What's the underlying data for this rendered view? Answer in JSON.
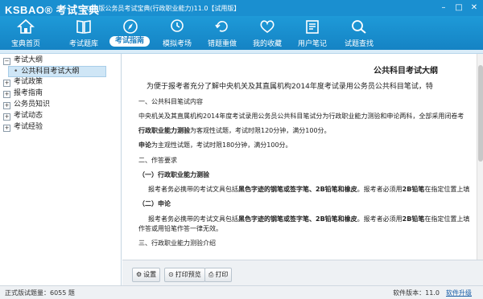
{
  "app": {
    "logo": "KSBAO® 考试宝典",
    "title": "2014版公务员考试宝典(行政职业能力)11.0【试用版】",
    "window_buttons": [
      "minimize",
      "maximize",
      "close"
    ]
  },
  "toolbar": {
    "items": [
      {
        "label": "宝典首页",
        "icon": "home-icon"
      },
      {
        "label": "考试题库",
        "icon": "book-icon"
      },
      {
        "label": "考试指南",
        "icon": "compass-icon",
        "active": true
      },
      {
        "label": "模拟考场",
        "icon": "monitor-icon"
      },
      {
        "label": "错题重做",
        "icon": "refresh-icon"
      },
      {
        "label": "我的收藏",
        "icon": "heart-icon"
      },
      {
        "label": "用户笔记",
        "icon": "notes-icon"
      },
      {
        "label": "试题查找",
        "icon": "search-icon"
      }
    ]
  },
  "sidebar": {
    "items": [
      {
        "label": "考试大纲",
        "expanded": true
      },
      {
        "label": "公共科目考试大纲",
        "selected": true,
        "child": true
      },
      {
        "label": "考试政策"
      },
      {
        "label": "报考指南"
      },
      {
        "label": "公务员知识"
      },
      {
        "label": "考试动态"
      },
      {
        "label": "考试经验"
      }
    ]
  },
  "document": {
    "title": "公共科目考试大纲",
    "intro": "为便于报考者充分了解中央机关及其直属机构2014年度考试录用公务员公共科目笔试，特",
    "sec1": "一、公共科目笔试内容",
    "p1": "中央机关及其直属机构2014年度考试录用公务员公共科目笔试分为行政职业能力测验和申论两科，全部采用闭卷考",
    "p2_bold": "行政职业能力测验",
    "p2_rest": "为客观性试题，考试时限120分钟，满分100分。",
    "p3_bold": "申论",
    "p3_rest": "为主观性试题，考试时限180分钟，满分100分。",
    "sec2": "二、作答要求",
    "sub1": "（一）行政职业能力测验",
    "p4_a": "报考者务必携带的考试文具包括",
    "p4_b": "黑色字迹的钢笔或签字笔、2B铅笔和橡皮",
    "p4_c": "。报考者必须用",
    "p4_d": "2B铅笔",
    "p4_e": "在指定位置上填",
    "sub2": "（二）申论",
    "p5_a": "报考者务必携带的考试文具包括",
    "p5_b": "黑色字迹的钢笔或签字笔、2B铅笔和橡皮",
    "p5_c": "。报考者必须用",
    "p5_d": "2B铅笔",
    "p5_e": "在指定位置上填",
    "p6": "作答或用铅笔作答一律无效。",
    "sec3": "三、行政职业能力测验介绍"
  },
  "actions": {
    "settings": "设置",
    "print_preview": "打印预览",
    "print": "打印"
  },
  "status": {
    "count": "正式版试题量：6055 题",
    "version": "软件版本：11.0",
    "upgrade": "软件升级"
  }
}
